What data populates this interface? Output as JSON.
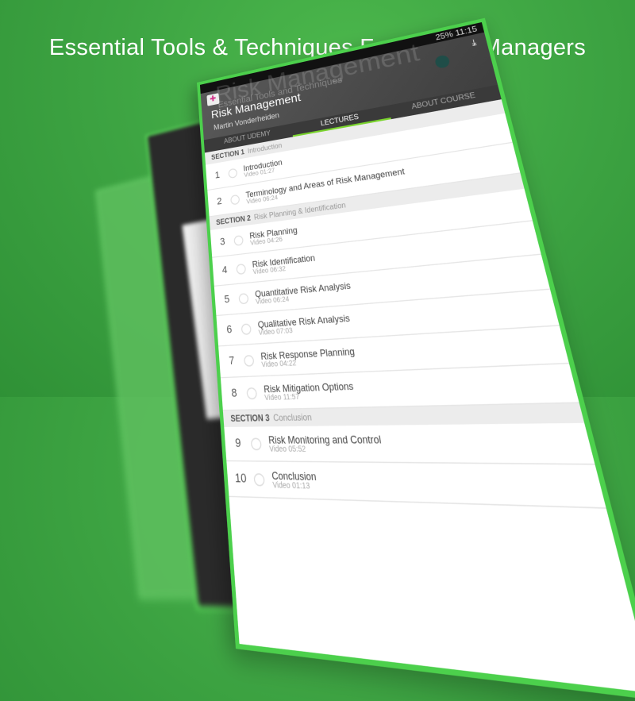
{
  "headline": "Essential Tools & Techniques For Project Managers",
  "status": {
    "battery": "25%",
    "time": "11:15"
  },
  "course": {
    "bg_title": "Risk Management",
    "bg_subtitle": "Essential Tools and Techniques",
    "title": "Risk Management",
    "author": "Martin Vonderheiden"
  },
  "tabs": [
    "ABOUT UDEMY",
    "LECTURES",
    "ABOUT COURSE"
  ],
  "sections": [
    {
      "label": "SECTION 1",
      "name": "Introduction",
      "lectures": [
        {
          "n": "1",
          "title": "Introduction",
          "sub": "Video 01:27"
        },
        {
          "n": "2",
          "title": "Terminology and Areas of Risk Management",
          "sub": "Video 06:24"
        }
      ]
    },
    {
      "label": "SECTION 2",
      "name": "Risk Planning & Identification",
      "lectures": [
        {
          "n": "3",
          "title": "Risk Planning",
          "sub": "Video 04:26"
        },
        {
          "n": "4",
          "title": "Risk Identification",
          "sub": "Video 06:32"
        },
        {
          "n": "5",
          "title": "Quantitative Risk Analysis",
          "sub": "Video 06:24"
        },
        {
          "n": "6",
          "title": "Qualitative Risk Analysis",
          "sub": "Video 07:03"
        },
        {
          "n": "7",
          "title": "Risk Response Planning",
          "sub": "Video 04:22"
        },
        {
          "n": "8",
          "title": "Risk Mitigation Options",
          "sub": "Video 11:57"
        }
      ]
    },
    {
      "label": "SECTION 3",
      "name": "Conclusion",
      "lectures": [
        {
          "n": "9",
          "title": "Risk Monitoring and Control",
          "sub": "Video 05:52"
        },
        {
          "n": "10",
          "title": "Conclusion",
          "sub": "Video 01:13"
        }
      ]
    }
  ]
}
